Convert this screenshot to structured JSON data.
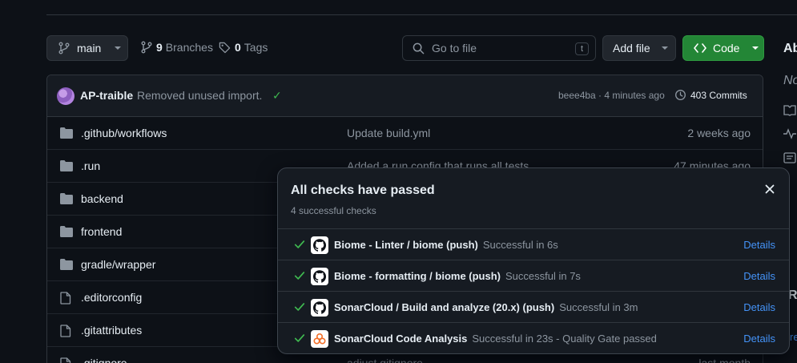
{
  "toolbar": {
    "branch": "main",
    "branches_count": "9",
    "branches_label": "Branches",
    "tags_count": "0",
    "tags_label": "Tags",
    "search_placeholder": "Go to file",
    "search_shortcut": "t",
    "add_file_label": "Add file",
    "code_label": "Code"
  },
  "latest_commit": {
    "author": "AP-traible",
    "message": "Removed unused import.",
    "sha_time": "beee4ba · 4 minutes ago",
    "commits_label": "403 Commits"
  },
  "files": [
    {
      "name": ".github/workflows",
      "message": "Update build.yml",
      "date": "2 weeks ago",
      "icon": "folder-icon"
    },
    {
      "name": ".run",
      "message": "Added a run config that runs all tests",
      "date": "47 minutes ago",
      "icon": "folder-icon"
    },
    {
      "name": "backend",
      "message": "",
      "date": "",
      "icon": "folder-icon"
    },
    {
      "name": "frontend",
      "message": "",
      "date": "",
      "icon": "folder-icon"
    },
    {
      "name": "gradle/wrapper",
      "message": "",
      "date": "",
      "icon": "folder-icon"
    },
    {
      "name": ".editorconfig",
      "message": "",
      "date": "",
      "icon": "file-icon"
    },
    {
      "name": ".gitattributes",
      "message": "",
      "date": "",
      "icon": "file-icon"
    },
    {
      "name": ".gitignore",
      "message": "adjust gitignore",
      "date": "last month",
      "icon": "file-icon"
    }
  ],
  "about": {
    "title": "Ab",
    "desc": "No",
    "releases": "Re",
    "link": "re"
  },
  "checks_popover": {
    "title": "All checks have passed",
    "subtitle": "4 successful checks",
    "checks": [
      {
        "name": "Biome - Linter / biome (push)",
        "status": "Successful in 6s",
        "details": "Details",
        "app": "github-icon"
      },
      {
        "name": "Biome - formatting / biome (push)",
        "status": "Successful in 7s",
        "details": "Details",
        "app": "github-icon"
      },
      {
        "name": "SonarCloud / Build and analyze (20.x) (push)",
        "status": "Successful in 3m",
        "details": "Details",
        "app": "github-icon"
      },
      {
        "name": "SonarCloud Code Analysis",
        "status": "Successful in 23s - Quality Gate passed",
        "details": "Details",
        "app": "sonarcloud-icon"
      }
    ]
  },
  "colors": {
    "background": "#0d1117",
    "accent_green": "#238636",
    "success": "#3fb950",
    "link": "#4493f8"
  }
}
